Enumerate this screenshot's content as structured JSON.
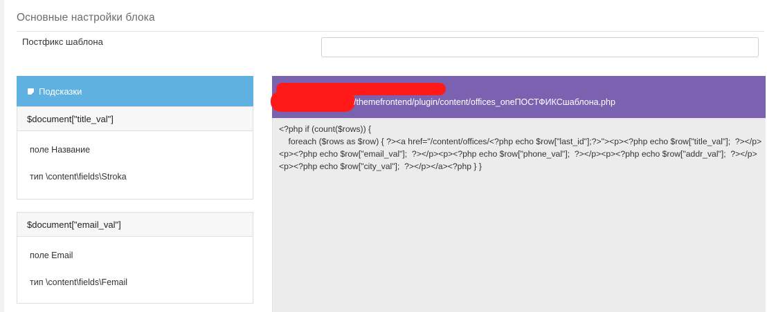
{
  "section": {
    "title": "Основные настройки блока"
  },
  "postfix_field": {
    "label": "Постфикс шаблона",
    "value": ""
  },
  "hints": {
    "header": "Подсказки",
    "cards": [
      {
        "variable": "$document[\"title_val\"]",
        "field_line": "поле Название",
        "type_line": "тип \\content\\fields\\Stroka"
      },
      {
        "variable": "$document[\"email_val\"]",
        "field_line": "поле Email",
        "type_line": "тип \\content\\fields\\Femail"
      }
    ]
  },
  "code_panel": {
    "path": "/themefrontend/plugin/content/offices_oneПОСТФИКСшаблона.php",
    "code": "<?php if (count($rows)) {\n    foreach ($rows as $row) { ?><a href=\"/content/offices/<?php echo $row[\"last_id\"];?>\"><p><?php echo $row[\"title_val\"];  ?></p><p><?php echo $row[\"email_val\"];  ?></p><p><?php echo $row[\"phone_val\"];  ?></p><p><?php echo $row[\"addr_val\"];  ?></p><p><?php echo $row[\"city_val\"];  ?></p></a><?php } }"
  },
  "colors": {
    "hints_header_bg": "#5eb1e0",
    "code_header_bg": "#7b62b0",
    "code_body_bg": "#ececec",
    "redaction": "#ff1a1a"
  },
  "icons": {
    "hints_icon": "note-icon"
  }
}
